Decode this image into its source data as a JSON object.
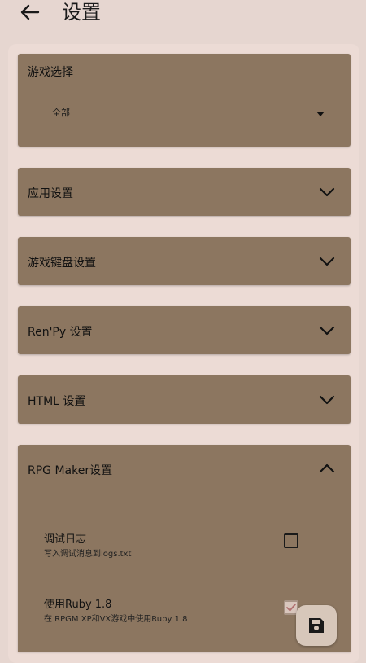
{
  "header": {
    "back_icon": "arrow-left-icon",
    "title": "设置"
  },
  "game_select": {
    "title": "游戏选择",
    "selected": "全部"
  },
  "sections": [
    {
      "label": "应用设置",
      "expanded": false
    },
    {
      "label": "游戏键盘设置",
      "expanded": false
    },
    {
      "label": "Ren'Py 设置",
      "expanded": false
    },
    {
      "label": "HTML 设置",
      "expanded": false
    },
    {
      "label": "RPG Maker设置",
      "expanded": true
    }
  ],
  "rpg_options": [
    {
      "label": "调试日志",
      "description": "写入调试消息到logs.txt",
      "checked": false
    },
    {
      "label": "使用Ruby 1.8",
      "description": "在 RPGM XP和VX游戏中使用Ruby 1.8",
      "checked": true
    }
  ],
  "fab": {
    "icon": "save-icon"
  },
  "colors": {
    "background": "#e6d6d0",
    "card": "#8c7660",
    "fab": "#d7c7ba"
  }
}
